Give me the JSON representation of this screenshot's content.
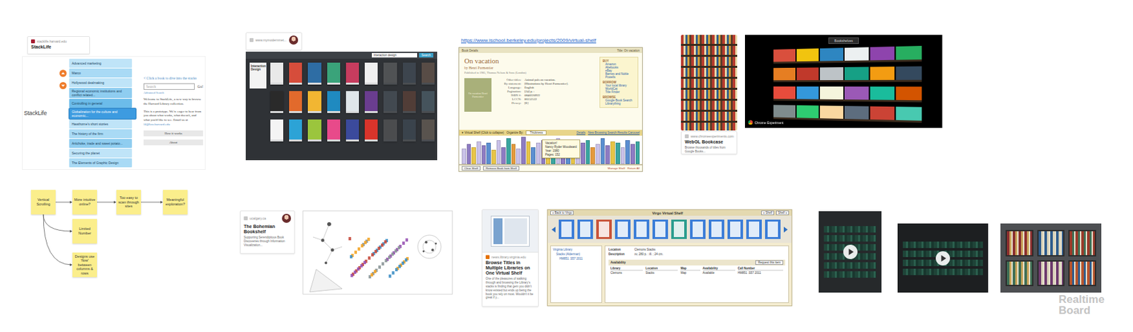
{
  "board": {
    "watermark": [
      "Realtime",
      "Board"
    ]
  },
  "stacklife": {
    "source": "stacklife.harvard.edu",
    "title": "StackLife",
    "app": {
      "logo": "StackLife",
      "books": [
        {
          "title": "Advanced marketing",
          "color": "#bfe4f8",
          "selected": false
        },
        {
          "title": "Marco",
          "color": "#a9daf5",
          "selected": false
        },
        {
          "title": "Hollywood dealmaking",
          "color": "#bfe4f8",
          "selected": false
        },
        {
          "title": "Regional economic institutions and conflict related...",
          "color": "#8fcdf0",
          "selected": false
        },
        {
          "title": "Controlling in general",
          "color": "#6cbcea",
          "selected": false
        },
        {
          "title": "Globalization for the culture and economic...",
          "color": "#3d9be0",
          "selected": true
        },
        {
          "title": "Hawthorne's short stories",
          "color": "#bfe4f8",
          "selected": false
        },
        {
          "title": "The history of the firm",
          "color": "#a9daf5",
          "selected": false
        },
        {
          "title": "Artichoke, trade and sweet potato...",
          "color": "#8fcdf0",
          "selected": false
        },
        {
          "title": "Securing the planet",
          "color": "#bfe4f8",
          "selected": false
        },
        {
          "title": "The Elements of Graphic Design",
          "color": "#a9daf5",
          "selected": false
        }
      ],
      "hint": "< Click a book to dive into the stacks",
      "search": {
        "placeholder": "Search",
        "button": "Go!",
        "advanced": "Advanced Search"
      },
      "welcome": "Welcome to StackLife, a new way to browse the Harvard Library collection.",
      "prototype": "This is a prototype. We're eager to hear from you about what works, what doesn't, and what you'd like to see. Email us at",
      "email": "lil@law.harvard.edu",
      "buttons": [
        "How it works",
        "About"
      ]
    }
  },
  "bookshelf": {
    "source": "www.mymodernmet...",
    "app": {
      "search": "interaction design",
      "button": "Search",
      "panel_title": "Interaction Design",
      "covers": [
        {
          "color": "#e9e9e9",
          "faded": false
        },
        {
          "color": "#d64d3b",
          "faded": false
        },
        {
          "color": "#2e6da4",
          "faded": false
        },
        {
          "color": "#3aa37a",
          "faded": false
        },
        {
          "color": "#c73c5e",
          "faded": false
        },
        {
          "color": "#f0f0f0",
          "faded": false
        },
        {
          "color": "#7a7a7a",
          "faded": true
        },
        {
          "color": "#4f5d6b",
          "faded": true
        },
        {
          "color": "#8a6d5a",
          "faded": true
        },
        {
          "color": "#2a2a2a",
          "faded": false
        },
        {
          "color": "#e26a2c",
          "faded": false
        },
        {
          "color": "#f2b632",
          "faded": false
        },
        {
          "color": "#1f8ac0",
          "faded": false
        },
        {
          "color": "#dfe6ea",
          "faded": false
        },
        {
          "color": "#6a3d8f",
          "faded": false
        },
        {
          "color": "#5a6670",
          "faded": true
        },
        {
          "color": "#7b4b3a",
          "faded": true
        },
        {
          "color": "#607d8b",
          "faded": true
        },
        {
          "color": "#f4f4f4",
          "faded": false
        },
        {
          "color": "#2ca3d6",
          "faded": false
        },
        {
          "color": "#9bc53d",
          "faded": false
        },
        {
          "color": "#e84a8a",
          "faded": false
        },
        {
          "color": "#3b4a9c",
          "faded": false
        },
        {
          "color": "#d9342b",
          "faded": false
        },
        {
          "color": "#6d6d6d",
          "faded": true
        },
        {
          "color": "#495867",
          "faded": true
        },
        {
          "color": "#8c7b6b",
          "faded": true
        }
      ]
    }
  },
  "virtual_shelf": {
    "link": "https://www.ischool.berkeley.edu/projects/2009/virtual-shelf",
    "app": {
      "header_left": "Book Details",
      "header_right": "Title: On vacation",
      "title": "On vacation",
      "author": "by Henri Parmentier",
      "published": "Published in 1985, Thomas Nelson & Sons (London)",
      "cover_text": "On vacation Henri Parmentier",
      "fields": [
        {
          "label": "Other titles:",
          "value": "Animal pals on vacation."
        },
        {
          "label": "By statement:",
          "value": "[Illustrations by Henri Parmentier]."
        },
        {
          "label": "Language:",
          "value": "English"
        },
        {
          "label": "Pagination:",
          "value": "[24] p. :"
        },
        {
          "label": "ISBN #:",
          "value": "0840320922"
        },
        {
          "label": "LCCN:",
          "value": "86152522"
        },
        {
          "label": "Dewey:",
          "value": "[E]"
        }
      ],
      "links": [
        {
          "heading": "BUY",
          "items": [
            "Amazon",
            "Abebooks",
            "eBay",
            "Barnes and Noble",
            "Powells"
          ]
        },
        {
          "heading": "BORROW",
          "items": [
            "Your local library",
            "WorldCat",
            "Title Finder"
          ]
        },
        {
          "heading": "BROWSE",
          "items": [
            "Google Book Search",
            "Librarything"
          ]
        }
      ],
      "shelf_bar": {
        "label": "▾ Virtual Shelf (Click to collapse)",
        "organize": "Organize By:",
        "value": "Thickness",
        "links": [
          "Details",
          "New Browsing Search Results Carousel"
        ]
      },
      "spines": [
        {
          "color": "#c9c1e8",
          "level": 0.55
        },
        {
          "color": "#8e7cc3",
          "level": 0.7
        },
        {
          "color": "#e8c547",
          "level": 0.6
        },
        {
          "color": "#c9c1e8",
          "level": 0.8
        },
        {
          "color": "#8e7cc3",
          "level": 0.65
        },
        {
          "color": "#5b8fd1",
          "level": 0.75
        },
        {
          "color": "#e8c547",
          "level": 0.5
        },
        {
          "color": "#c9c1e8",
          "level": 0.85
        },
        {
          "color": "#8e7cc3",
          "level": 0.6
        },
        {
          "color": "#3aa6a0",
          "level": 0.9
        },
        {
          "color": "#e59a3c",
          "level": 0.7
        },
        {
          "color": "#c9c1e8",
          "level": 0.55
        },
        {
          "color": "#8e7cc3",
          "level": 0.95
        },
        {
          "color": "#e8c547",
          "level": 0.8
        },
        {
          "color": "#5b8fd1",
          "level": 0.6
        },
        {
          "color": "#c9c1e8",
          "level": 0.75
        },
        {
          "color": "#8e7cc3",
          "level": 0.85
        },
        {
          "color": "#e8c547",
          "level": 0.65
        },
        {
          "color": "#3aa6a0",
          "level": 0.7
        },
        {
          "color": "#c9c1e8",
          "level": 0.9
        },
        {
          "color": "#8e7cc3",
          "level": 0.6
        },
        {
          "color": "#5b8fd1",
          "level": 0.8
        },
        {
          "color": "#e8c547",
          "level": 0.7
        },
        {
          "color": "#c9c1e8",
          "level": 0.55
        },
        {
          "color": "#8e7cc3",
          "level": 0.75
        },
        {
          "color": "#3aa6a0",
          "level": 0.85
        },
        {
          "color": "#e59a3c",
          "level": 0.6
        },
        {
          "color": "#c9c1e8",
          "level": 0.7
        },
        {
          "color": "#5b8fd1",
          "level": 0.9
        },
        {
          "color": "#8e7cc3",
          "level": 0.65
        },
        {
          "color": "#e8c547",
          "level": 0.8
        },
        {
          "color": "#3aa6a0",
          "level": 0.75
        },
        {
          "color": "#c9c1e8",
          "level": 0.6
        },
        {
          "color": "#5b8fd1",
          "level": 0.85
        },
        {
          "color": "#8e7cc3",
          "level": 0.7
        },
        {
          "color": "#3aa6a0",
          "level": 0.8
        }
      ],
      "tooltip": {
        "title": "Vacation!",
        "lines": [
          "Nancy Ryder Woodward",
          "Year: 1980",
          "Pages: 152"
        ]
      },
      "buttons": [
        "Clear Shelf",
        "Remove Book from Shelf"
      ],
      "footer_links": [
        "Manage Shelf",
        "Return All"
      ]
    }
  },
  "webgl": {
    "source": "www.chromeexperiments.com",
    "title": "WebGL Bookcase",
    "description": "Browse thousands of titles from Google Books...",
    "app": {
      "label": "Bookshelves",
      "credit": "Chrome Experiment",
      "books": [
        "#d94f3d",
        "#f1c40f",
        "#2e86c1",
        "#ecf0f1",
        "#8e44ad",
        "#27ae60",
        "#e67e22",
        "#c0392b",
        "#bdc3c7",
        "#16a085",
        "#f39c12",
        "#34495e",
        "#e74c3c",
        "#3498db",
        "#f5f5dc",
        "#9b59b6",
        "#1abc9c",
        "#d35400",
        "#7f8c8d",
        "#2ecc71",
        "#fad7a0",
        "#5d6d7e",
        "#cb4335",
        "#48c9b0"
      ]
    }
  },
  "stickies": [
    {
      "text": "Vertical Scrolling"
    },
    {
      "text": "More intuitive online?"
    },
    {
      "text": "Too easy to scan through sites"
    },
    {
      "text": "Meaningful exploration?"
    },
    {
      "text": "Limited Number"
    },
    {
      "text": "Designs use 'flow' between columns & rows"
    }
  ],
  "bohemian": {
    "source": "ucalgary.ca",
    "title": "The Bohemian Bookshelf",
    "description": "Supporting Serendipitous Book Discoveries through Information Visualization..."
  },
  "virginia": {
    "source": "news.library.virginia.edu",
    "title": "Browse Titles in Multiple Libraries on One Virtual Shelf",
    "description": "One of the pleasures of walking through and browsing the Library's stacks is finding that gem you didn't know existed but ends up being the book you rely on most. Wouldn't it be great if y..."
  },
  "virgo": {
    "back": "« Back to Virgo",
    "title": "Virgo Virtual Shelf",
    "nav": [
      "« Shelf",
      "Shelf »"
    ],
    "covers": [
      "#3b7dd8",
      "#3b7dd8",
      "#c8543a",
      "#3b7dd8",
      "#3b7dd8",
      "#3b7dd8",
      "#2a9d8f",
      "#3b7dd8",
      "#3b7dd8",
      "#3b7dd8",
      "#3b7dd8",
      "#3b7dd8"
    ],
    "tree": [
      "Virginia Library",
      "Stacks (Alderman)",
      "HM851 .S57 2011"
    ],
    "details": [
      {
        "label": "Location",
        "value": "Clemons Stacks"
      },
      {
        "label": "Description",
        "value": "xv, 280 p. : ill. ; 24 cm."
      }
    ],
    "availability": {
      "title": "Availability",
      "button": "Request this item",
      "columns": [
        "Library",
        "Location",
        "Map",
        "Availability",
        "Call Number"
      ],
      "rows": [
        [
          "Clemons",
          "Stacks",
          "Map",
          "Available",
          "HM851 .S57 2011"
        ]
      ]
    }
  }
}
